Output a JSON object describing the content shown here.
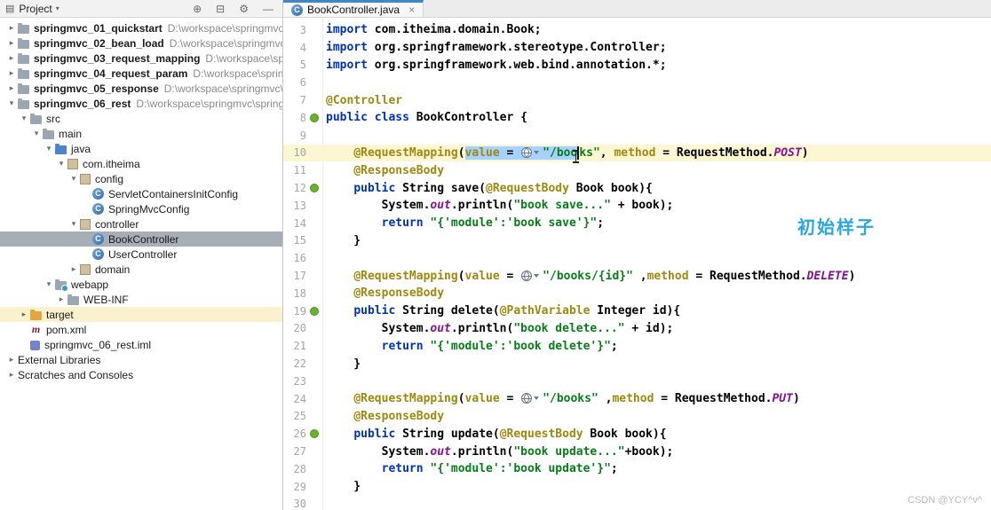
{
  "colors": {
    "tab_accent": "#3e86c8",
    "selection": "#a6d2ff",
    "caret_line": "#fdf6d3",
    "keyword": "#0033b3",
    "annotation": "#9e880d",
    "string": "#067d17",
    "field": "#871094",
    "spring_icon_green": "#64b42d",
    "tree_selection": "#a8aeb6",
    "overlay_annotation": "#2ba7e0"
  },
  "icon_glyphs": {
    "class": "C",
    "maven": "m"
  },
  "project_panel": {
    "header": {
      "tool_icon_glyph": "▤",
      "title": "Project",
      "dropdown_glyph": "▾",
      "actions": [
        {
          "name": "locate-icon",
          "glyph": "⊕"
        },
        {
          "name": "collapse-all-icon",
          "glyph": "⊟"
        },
        {
          "name": "settings-icon",
          "glyph": "⚙"
        },
        {
          "name": "hide-icon",
          "glyph": "—"
        }
      ]
    },
    "tree": [
      {
        "d": 0,
        "ch": "r",
        "ic": "folder",
        "lb": "springmvc_01_quickstart",
        "pa": "D:\\workspace\\springmvc\\",
        "bold": true
      },
      {
        "d": 0,
        "ch": "r",
        "ic": "folder",
        "lb": "springmvc_02_bean_load",
        "pa": "D:\\workspace\\springmvc\\",
        "bold": true
      },
      {
        "d": 0,
        "ch": "r",
        "ic": "folder",
        "lb": "springmvc_03_request_mapping",
        "pa": "D:\\workspace\\spri",
        "bold": true
      },
      {
        "d": 0,
        "ch": "r",
        "ic": "folder",
        "lb": "springmvc_04_request_param",
        "pa": "D:\\workspace\\spring",
        "bold": true
      },
      {
        "d": 0,
        "ch": "r",
        "ic": "folder",
        "lb": "springmvc_05_response",
        "pa": "D:\\workspace\\springmvc\\s",
        "bold": true
      },
      {
        "d": 0,
        "ch": "d",
        "ic": "folder",
        "lb": "springmvc_06_rest",
        "pa": "D:\\workspace\\springmvc\\spring",
        "bold": true
      },
      {
        "d": 1,
        "ch": "d",
        "ic": "folder",
        "lb": "src"
      },
      {
        "d": 2,
        "ch": "d",
        "ic": "folder",
        "lb": "main"
      },
      {
        "d": 3,
        "ch": "d",
        "ic": "folder-src",
        "lb": "java"
      },
      {
        "d": 4,
        "ch": "d",
        "ic": "package",
        "lb": "com.itheima"
      },
      {
        "d": 5,
        "ch": "d",
        "ic": "package",
        "lb": "config"
      },
      {
        "d": 6,
        "ic": "class",
        "lb": "ServletContainersInitConfig"
      },
      {
        "d": 6,
        "ic": "class",
        "lb": "SpringMvcConfig"
      },
      {
        "d": 5,
        "ch": "d",
        "ic": "package",
        "lb": "controller"
      },
      {
        "d": 6,
        "ic": "class",
        "lb": "BookController",
        "sel": true
      },
      {
        "d": 6,
        "ic": "class",
        "lb": "UserController"
      },
      {
        "d": 5,
        "ch": "r",
        "ic": "package",
        "lb": "domain"
      },
      {
        "d": 3,
        "ch": "d",
        "ic": "folder-web",
        "lb": "webapp"
      },
      {
        "d": 4,
        "ch": "r",
        "ic": "folder",
        "lb": "WEB-INF"
      },
      {
        "d": 1,
        "ch": "r",
        "ic": "folder-orange",
        "lb": "target",
        "bg": "#faf1cf"
      },
      {
        "d": 1,
        "ic": "maven",
        "lb": "pom.xml"
      },
      {
        "d": 1,
        "ic": "iml",
        "lb": "springmvc_06_rest.iml"
      },
      {
        "d": 0,
        "ch": "r",
        "lb": "External Libraries"
      },
      {
        "d": 0,
        "ch": "r",
        "lb": "Scratches and Consoles"
      }
    ]
  },
  "editor": {
    "tab": {
      "label": "BookController.java",
      "close_glyph": "×"
    },
    "lines": [
      {
        "num": 3,
        "segs": [
          {
            "t": "import",
            "c": "k"
          },
          {
            "t": " com.itheima.domain.Book;",
            "c": "p"
          }
        ]
      },
      {
        "num": 4,
        "segs": [
          {
            "t": "import",
            "c": "k"
          },
          {
            "t": " org.springframework.stereotype.Controller;",
            "c": "p"
          }
        ]
      },
      {
        "num": 5,
        "segs": [
          {
            "t": "import",
            "c": "k"
          },
          {
            "t": " org.springframework.web.bind.annotation.*;",
            "c": "p"
          }
        ]
      },
      {
        "num": 6,
        "segs": []
      },
      {
        "num": 7,
        "segs": [
          {
            "t": "@Controller",
            "c": "a"
          }
        ]
      },
      {
        "num": 8,
        "icon": "spring",
        "segs": [
          {
            "t": "public class",
            "c": "k"
          },
          {
            "t": " BookController {",
            "c": "p"
          }
        ]
      },
      {
        "num": 9,
        "segs": []
      },
      {
        "num": 10,
        "hl": true,
        "segs": [
          {
            "t": "    ",
            "c": "p"
          },
          {
            "t": "@RequestMapping",
            "c": "a"
          },
          {
            "t": "(",
            "c": "p"
          },
          {
            "t": "value",
            "c": "a",
            "sel": 1
          },
          {
            "t": " = ",
            "c": "p",
            "sel": 1
          },
          {
            "ic": 1,
            "sel": 1
          },
          {
            "t": "\"/boo",
            "c": "s",
            "sel": 1
          },
          {
            "cr": 1
          },
          {
            "t": "ks\"",
            "c": "s"
          },
          {
            "t": ", ",
            "c": "p"
          },
          {
            "t": "method",
            "c": "a"
          },
          {
            "t": " = RequestMethod.",
            "c": "p"
          },
          {
            "t": "POST",
            "c": "q"
          },
          {
            "t": ")",
            "c": "p"
          }
        ]
      },
      {
        "num": 11,
        "segs": [
          {
            "t": "    ",
            "c": "p"
          },
          {
            "t": "@ResponseBody",
            "c": "a"
          }
        ]
      },
      {
        "num": 12,
        "icon": "spring",
        "segs": [
          {
            "t": "    ",
            "c": "p"
          },
          {
            "t": "public",
            "c": "k"
          },
          {
            "t": " String save(",
            "c": "p"
          },
          {
            "t": "@RequestBody",
            "c": "a"
          },
          {
            "t": " Book book){",
            "c": "p"
          }
        ]
      },
      {
        "num": 13,
        "segs": [
          {
            "t": "        System.",
            "c": "p"
          },
          {
            "t": "out",
            "c": "f"
          },
          {
            "t": ".println(",
            "c": "p"
          },
          {
            "t": "\"book save...\"",
            "c": "s"
          },
          {
            "t": " + book);",
            "c": "p"
          }
        ]
      },
      {
        "num": 14,
        "segs": [
          {
            "t": "        ",
            "c": "p"
          },
          {
            "t": "return ",
            "c": "k"
          },
          {
            "t": "\"{'module':'book save'}\"",
            "c": "s"
          },
          {
            "t": ";",
            "c": "p"
          }
        ]
      },
      {
        "num": 15,
        "segs": [
          {
            "t": "    }",
            "c": "p"
          }
        ]
      },
      {
        "num": 16,
        "segs": []
      },
      {
        "num": 17,
        "segs": [
          {
            "t": "    ",
            "c": "p"
          },
          {
            "t": "@RequestMapping",
            "c": "a"
          },
          {
            "t": "(",
            "c": "p"
          },
          {
            "t": "value",
            "c": "a"
          },
          {
            "t": " = ",
            "c": "p"
          },
          {
            "ic": 1
          },
          {
            "t": "\"/books/{id}\"",
            "c": "s"
          },
          {
            "t": " ,",
            "c": "p"
          },
          {
            "t": "method",
            "c": "a"
          },
          {
            "t": " = RequestMethod.",
            "c": "p"
          },
          {
            "t": "DELETE",
            "c": "q"
          },
          {
            "t": ")",
            "c": "p"
          }
        ]
      },
      {
        "num": 18,
        "segs": [
          {
            "t": "    ",
            "c": "p"
          },
          {
            "t": "@ResponseBody",
            "c": "a"
          }
        ]
      },
      {
        "num": 19,
        "icon": "spring",
        "segs": [
          {
            "t": "    ",
            "c": "p"
          },
          {
            "t": "public",
            "c": "k"
          },
          {
            "t": " String delete(",
            "c": "p"
          },
          {
            "t": "@PathVariable",
            "c": "a"
          },
          {
            "t": " Integer id){",
            "c": "p"
          }
        ]
      },
      {
        "num": 20,
        "segs": [
          {
            "t": "        System.",
            "c": "p"
          },
          {
            "t": "out",
            "c": "f"
          },
          {
            "t": ".println(",
            "c": "p"
          },
          {
            "t": "\"book delete...\"",
            "c": "s"
          },
          {
            "t": " + id);",
            "c": "p"
          }
        ]
      },
      {
        "num": 21,
        "segs": [
          {
            "t": "        ",
            "c": "p"
          },
          {
            "t": "return ",
            "c": "k"
          },
          {
            "t": "\"{'module':'book delete'}\"",
            "c": "s"
          },
          {
            "t": ";",
            "c": "p"
          }
        ]
      },
      {
        "num": 22,
        "segs": [
          {
            "t": "    }",
            "c": "p"
          }
        ]
      },
      {
        "num": 23,
        "segs": []
      },
      {
        "num": 24,
        "segs": [
          {
            "t": "    ",
            "c": "p"
          },
          {
            "t": "@RequestMapping",
            "c": "a"
          },
          {
            "t": "(",
            "c": "p"
          },
          {
            "t": "value",
            "c": "a"
          },
          {
            "t": " = ",
            "c": "p"
          },
          {
            "ic": 1
          },
          {
            "t": "\"/books\"",
            "c": "s"
          },
          {
            "t": " ,",
            "c": "p"
          },
          {
            "t": "method",
            "c": "a"
          },
          {
            "t": " = RequestMethod.",
            "c": "p"
          },
          {
            "t": "PUT",
            "c": "q"
          },
          {
            "t": ")",
            "c": "p"
          }
        ]
      },
      {
        "num": 25,
        "segs": [
          {
            "t": "    ",
            "c": "p"
          },
          {
            "t": "@ResponseBody",
            "c": "a"
          }
        ]
      },
      {
        "num": 26,
        "icon": "spring",
        "segs": [
          {
            "t": "    ",
            "c": "p"
          },
          {
            "t": "public",
            "c": "k"
          },
          {
            "t": " String update(",
            "c": "p"
          },
          {
            "t": "@RequestBody",
            "c": "a"
          },
          {
            "t": " Book book){",
            "c": "p"
          }
        ]
      },
      {
        "num": 27,
        "segs": [
          {
            "t": "        System.",
            "c": "p"
          },
          {
            "t": "out",
            "c": "f"
          },
          {
            "t": ".println(",
            "c": "p"
          },
          {
            "t": "\"book update...\"",
            "c": "s"
          },
          {
            "t": "+book);",
            "c": "p"
          }
        ]
      },
      {
        "num": 28,
        "segs": [
          {
            "t": "        ",
            "c": "p"
          },
          {
            "t": "return ",
            "c": "k"
          },
          {
            "t": "\"{'module':'book update'}\"",
            "c": "s"
          },
          {
            "t": ";",
            "c": "p"
          }
        ]
      },
      {
        "num": 29,
        "segs": [
          {
            "t": "    }",
            "c": "p"
          }
        ]
      },
      {
        "num": 30,
        "segs": []
      }
    ]
  },
  "overlay": {
    "annotation_text": "初始样子",
    "watermark": "CSDN @YCY^v^"
  }
}
